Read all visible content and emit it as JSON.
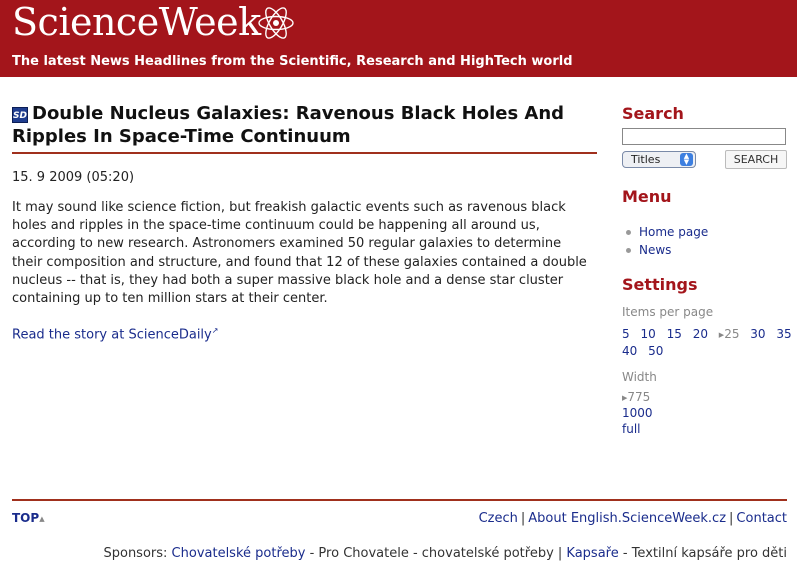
{
  "site": {
    "brand": "ScienceWeek",
    "tagline": "The latest News Headlines from the Scientific, Research and HighTech world",
    "logo_icon": "atom-icon",
    "header_color": "#a3151b"
  },
  "article": {
    "source_badge": "SD",
    "title": "Double Nucleus Galaxies: Ravenous Black Holes And Ripples In Space-Time Continuum",
    "date": "15. 9 2009 (05:20)",
    "body": "It may sound like science fiction, but freakish galactic events such as ravenous black holes and ripples in the space-time continuum could be happening all around us, according to new research. Astronomers examined 50 regular galaxies to determine their composition and structure, and found that 12 of these galaxies contained a double nucleus -- that is, they had both a super massive black hole and a dense star cluster containing up to ten million stars at their center.",
    "read_more": "Read the story at ScienceDaily"
  },
  "sidebar": {
    "search_heading": "Search",
    "search_value": "",
    "search_scope": "Titles",
    "search_button": "SEARCH",
    "menu_heading": "Menu",
    "menu_items": [
      "Home page",
      "News"
    ],
    "settings_heading": "Settings",
    "items_per_page_label": "Items per page",
    "items_per_page": [
      "5",
      "10",
      "15",
      "20",
      "25",
      "30",
      "35",
      "40",
      "50"
    ],
    "items_per_page_current": "25",
    "width_label": "Width",
    "widths": [
      "775",
      "1000",
      "full"
    ],
    "width_current": "775"
  },
  "footer": {
    "top_label": "TOP",
    "links": [
      "Czech",
      "About English.ScienceWeek.cz",
      "Contact"
    ],
    "sponsors_label": "Sponsors:",
    "sponsor_1": "Chovatelské potřeby",
    "sponsor_1_desc": "- Pro Chovatele - chovatelské potřeby |",
    "sponsor_2": "Kapsaře",
    "sponsor_2_desc": "- Textilní kapsáře pro děti"
  }
}
